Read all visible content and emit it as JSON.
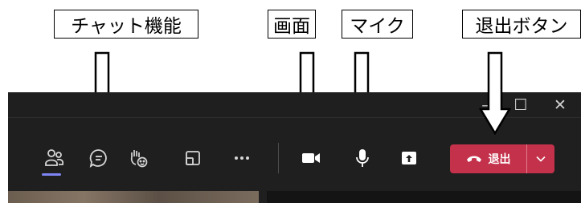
{
  "annotations": {
    "chat": "チャット機能",
    "screen": "画面",
    "mic": "マイク",
    "leave": "退出ボタン"
  },
  "window_controls": {
    "minimize": "–",
    "maximize": "☐",
    "close": "✕"
  },
  "toolbar": {
    "more_label": "•••",
    "leave_label": "退出"
  },
  "icons": {
    "people": "people-icon",
    "chat": "chat-icon",
    "react": "raise-hand-reaction-icon",
    "view": "view-layout-icon",
    "more": "more-options-icon",
    "camera": "camera-icon",
    "mic": "microphone-icon",
    "share": "share-screen-icon",
    "phone": "phone-hangup-icon",
    "dropdown": "chevron-down-icon"
  },
  "colors": {
    "toolbar_bg": "#1f1f1f",
    "leave_red": "#c4314b",
    "active_accent": "#7f85f5",
    "icon": "#d6d6d6"
  }
}
